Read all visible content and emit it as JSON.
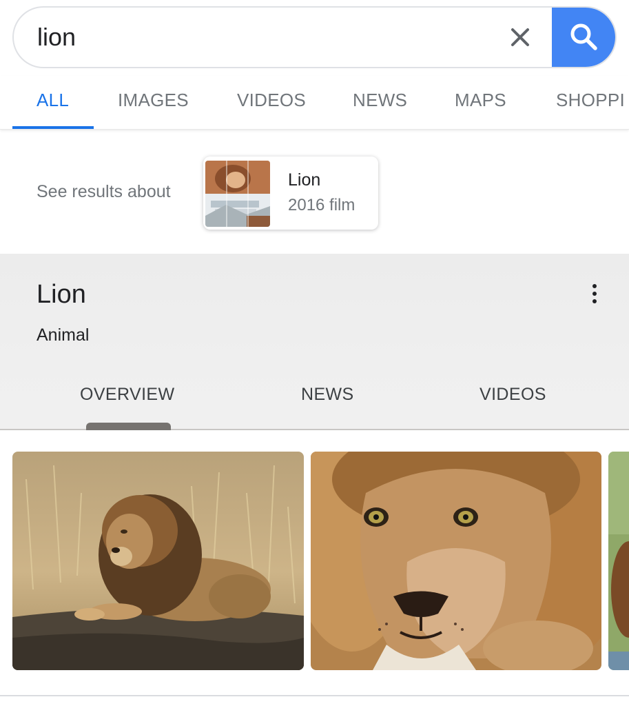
{
  "search": {
    "query": "lion",
    "clear_icon": "close-icon",
    "search_icon": "search-icon"
  },
  "tabs": [
    {
      "label": "ALL",
      "active": true
    },
    {
      "label": "IMAGES"
    },
    {
      "label": "VIDEOS"
    },
    {
      "label": "NEWS"
    },
    {
      "label": "MAPS"
    },
    {
      "label": "SHOPPI"
    }
  ],
  "see_results": {
    "label": "See results about",
    "entity": {
      "title": "Lion",
      "subtitle": "2016 film"
    }
  },
  "knowledge_panel": {
    "title": "Lion",
    "subtitle": "Animal",
    "menu_icon": "more-vert-icon",
    "tabs": [
      {
        "label": "OVERVIEW",
        "active": true
      },
      {
        "label": "NEWS"
      },
      {
        "label": "VIDEOS"
      }
    ]
  },
  "images": [
    {
      "name": "lion-lying-grass"
    },
    {
      "name": "lion-face-closeup"
    },
    {
      "name": "lion-partial"
    }
  ],
  "colors": {
    "accent": "#1a73e8",
    "search_button": "#4285f4",
    "muted_text": "#70757a",
    "panel_background": "#eeeeee"
  }
}
